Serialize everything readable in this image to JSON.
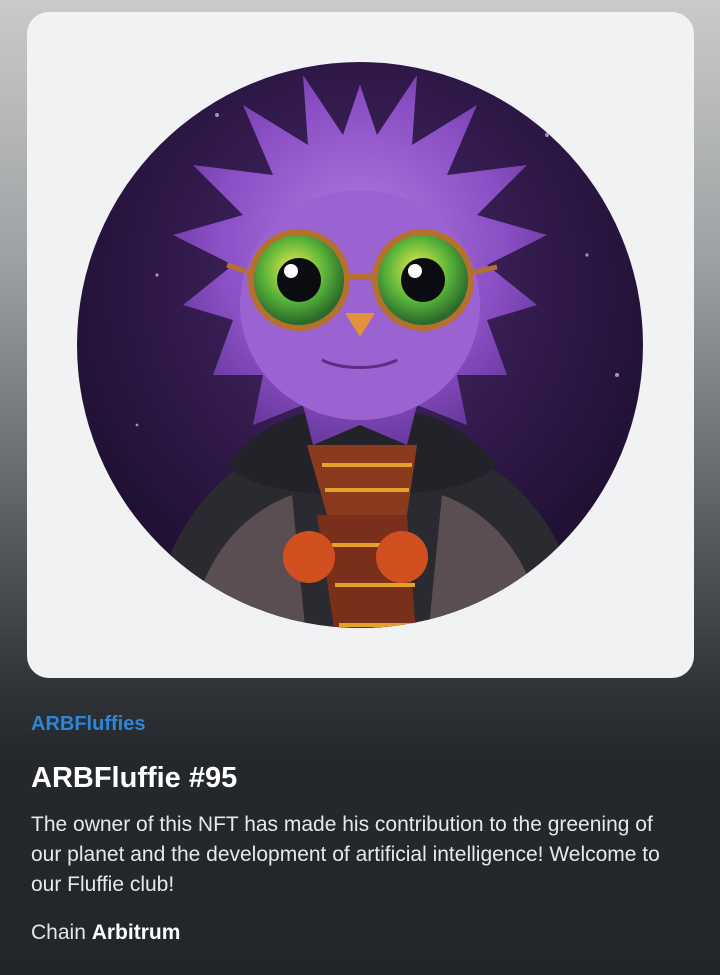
{
  "nft": {
    "collection": "ARBFluffies",
    "title": "ARBFluffie #95",
    "description": "The owner of this NFT has made his contribution to the greening of our planet and the development of artificial intelligence! Welcome to our Fluffie club!",
    "chain_label": "Chain",
    "chain_value": "Arbitrum"
  },
  "colors": {
    "accent": "#2c86d9",
    "card_bg": "#f1f2f3",
    "page_dark": "#232629"
  }
}
